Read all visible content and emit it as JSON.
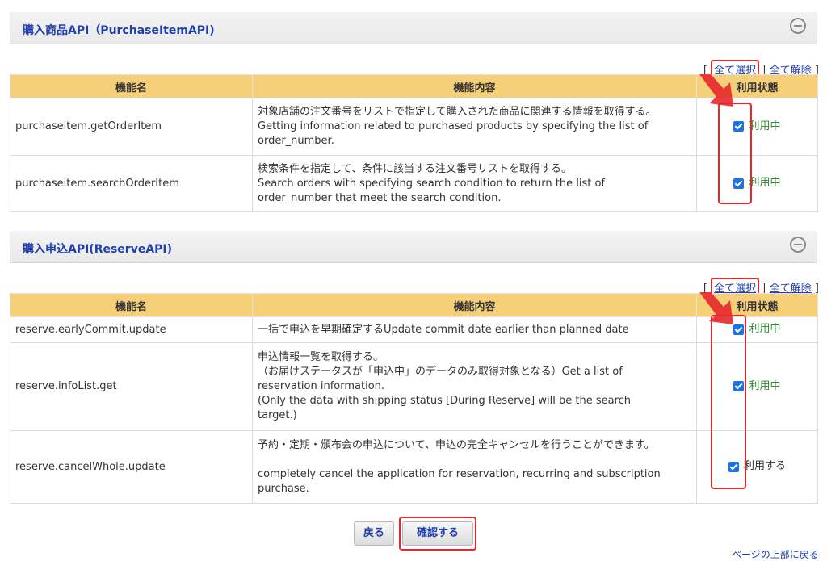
{
  "sections": [
    {
      "title": "購入商品API（PurchaseItemAPI)",
      "select_all": "全て選択",
      "deselect_all": "全て解除",
      "headers": [
        "機能名",
        "機能内容",
        "利用状態"
      ],
      "rows": [
        {
          "name": "purchaseitem.getOrderItem",
          "desc": "対象店舗の注文番号をリストで指定して購入された商品に関連する情報を取得する。\nGetting information related to purchased products by specifying the list of\norder_number.",
          "status": "利用中"
        },
        {
          "name": "purchaseitem.searchOrderItem",
          "desc": "検索条件を指定して、条件に該当する注文番号リストを取得する。\nSearch orders with specifying search condition to return the list of\norder_number that meet the search condition.",
          "status": "利用中"
        }
      ]
    },
    {
      "title": "購入申込API(ReserveAPI)",
      "select_all": "全て選択",
      "deselect_all": "全て解除",
      "headers": [
        "機能名",
        "機能内容",
        "利用状態"
      ],
      "rows": [
        {
          "name": "reserve.earlyCommit.update",
          "desc": "一括で申込を早期確定するUpdate commit date earlier than planned date",
          "status": "利用中"
        },
        {
          "name": "reserve.infoList.get",
          "desc": "申込情報一覧を取得する。\n（お届けステータスが「申込中」のデータのみ取得対象となる）Get a list of\nreservation information.\n(Only the data with shipping status [During Reserve] will be the search\ntarget.)",
          "status": "利用中"
        },
        {
          "name": "reserve.cancelWhole.update",
          "desc": "予約・定期・頒布会の申込について、申込の完全キャンセルを行うことができます。\n\ncompletely cancel the application for reservation, recurring and subscription\npurchase.",
          "status": "利用する"
        }
      ]
    }
  ],
  "buttons": {
    "back": "戻る",
    "confirm": "確認する"
  },
  "footer": {
    "page_top": "ページの上部に戻る"
  },
  "colors": {
    "header_bg": "#f6cf79",
    "title": "#1f3fae",
    "highlight": "#e8262c",
    "status_active": "#2f8a2f"
  }
}
